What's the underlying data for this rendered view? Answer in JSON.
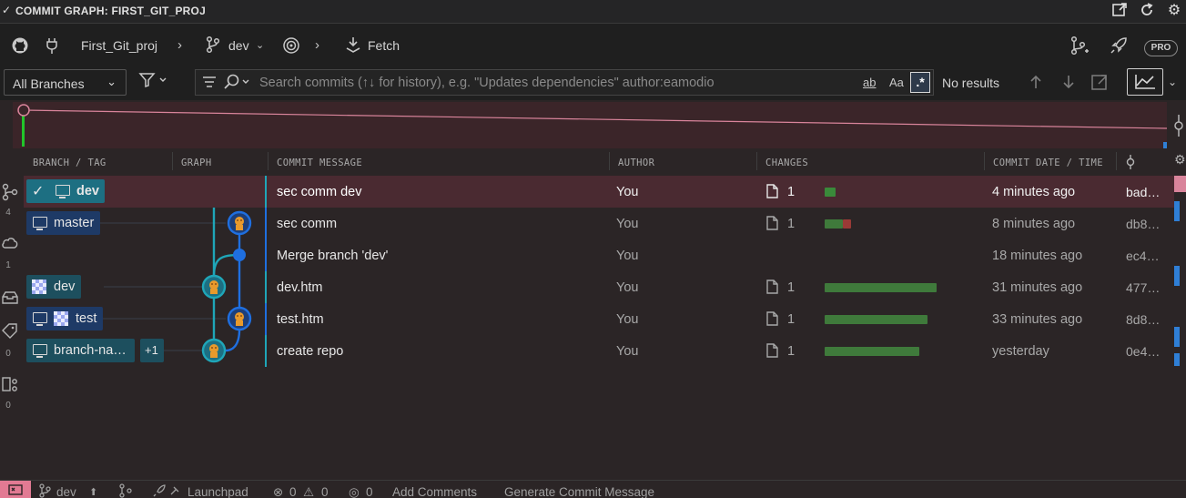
{
  "title": "COMMIT GRAPH: FIRST_GIT_PROJ",
  "toolbar": {
    "repo": "First_Git_proj",
    "branch": "dev",
    "fetch": "Fetch",
    "pro": "PRO"
  },
  "search": {
    "branch_filter": "All Branches",
    "placeholder": "Search commits (↑↓ for history), e.g. \"Updates dependencies\" author:eamodio",
    "results": "No results",
    "opt_word": "ab",
    "opt_case": "Aa",
    "opt_regex": ".*"
  },
  "columns": {
    "branch": "BRANCH / TAG",
    "graph": "GRAPH",
    "message": "COMMIT MESSAGE",
    "author": "AUTHOR",
    "changes": "CHANGES",
    "date": "COMMIT DATE / TIME"
  },
  "activity": {
    "count1": "4",
    "count2": "1",
    "count3": "0",
    "count4": "0"
  },
  "rows": [
    {
      "branch": "dev",
      "message": "sec comm dev",
      "author": "You",
      "changes": "1",
      "date": "4 minutes ago",
      "sha": "bad…"
    },
    {
      "branch": "master",
      "message": "sec comm",
      "author": "You",
      "changes": "1",
      "date": "8 minutes ago",
      "sha": "db8…"
    },
    {
      "branch": "",
      "message": "Merge branch 'dev'",
      "author": "You",
      "changes": "",
      "date": "18 minutes ago",
      "sha": "ec4…"
    },
    {
      "branch": "dev",
      "message": "dev.htm",
      "author": "You",
      "changes": "1",
      "date": "31 minutes ago",
      "sha": "477…"
    },
    {
      "branch": "test",
      "message": "test.htm",
      "author": "You",
      "changes": "1",
      "date": "33 minutes ago",
      "sha": "8d8…"
    },
    {
      "branch": "branch-na…",
      "extra": "+1",
      "message": "create repo",
      "author": "You",
      "changes": "1",
      "date": "yesterday",
      "sha": "0e4…"
    }
  ],
  "statusbar": {
    "branch": "dev",
    "launchpad": "Launchpad",
    "errors": "0",
    "warnings": "0",
    "ports": "0",
    "add_comments": "Add Comments",
    "generate": "Generate Commit Message"
  },
  "colors": {
    "selected_row": "#4a2a31",
    "lane_teal": "#1fa6b8",
    "lane_blue": "#1f6fe0",
    "additions": "#3f7a3b",
    "deletions": "#9a3a36"
  }
}
